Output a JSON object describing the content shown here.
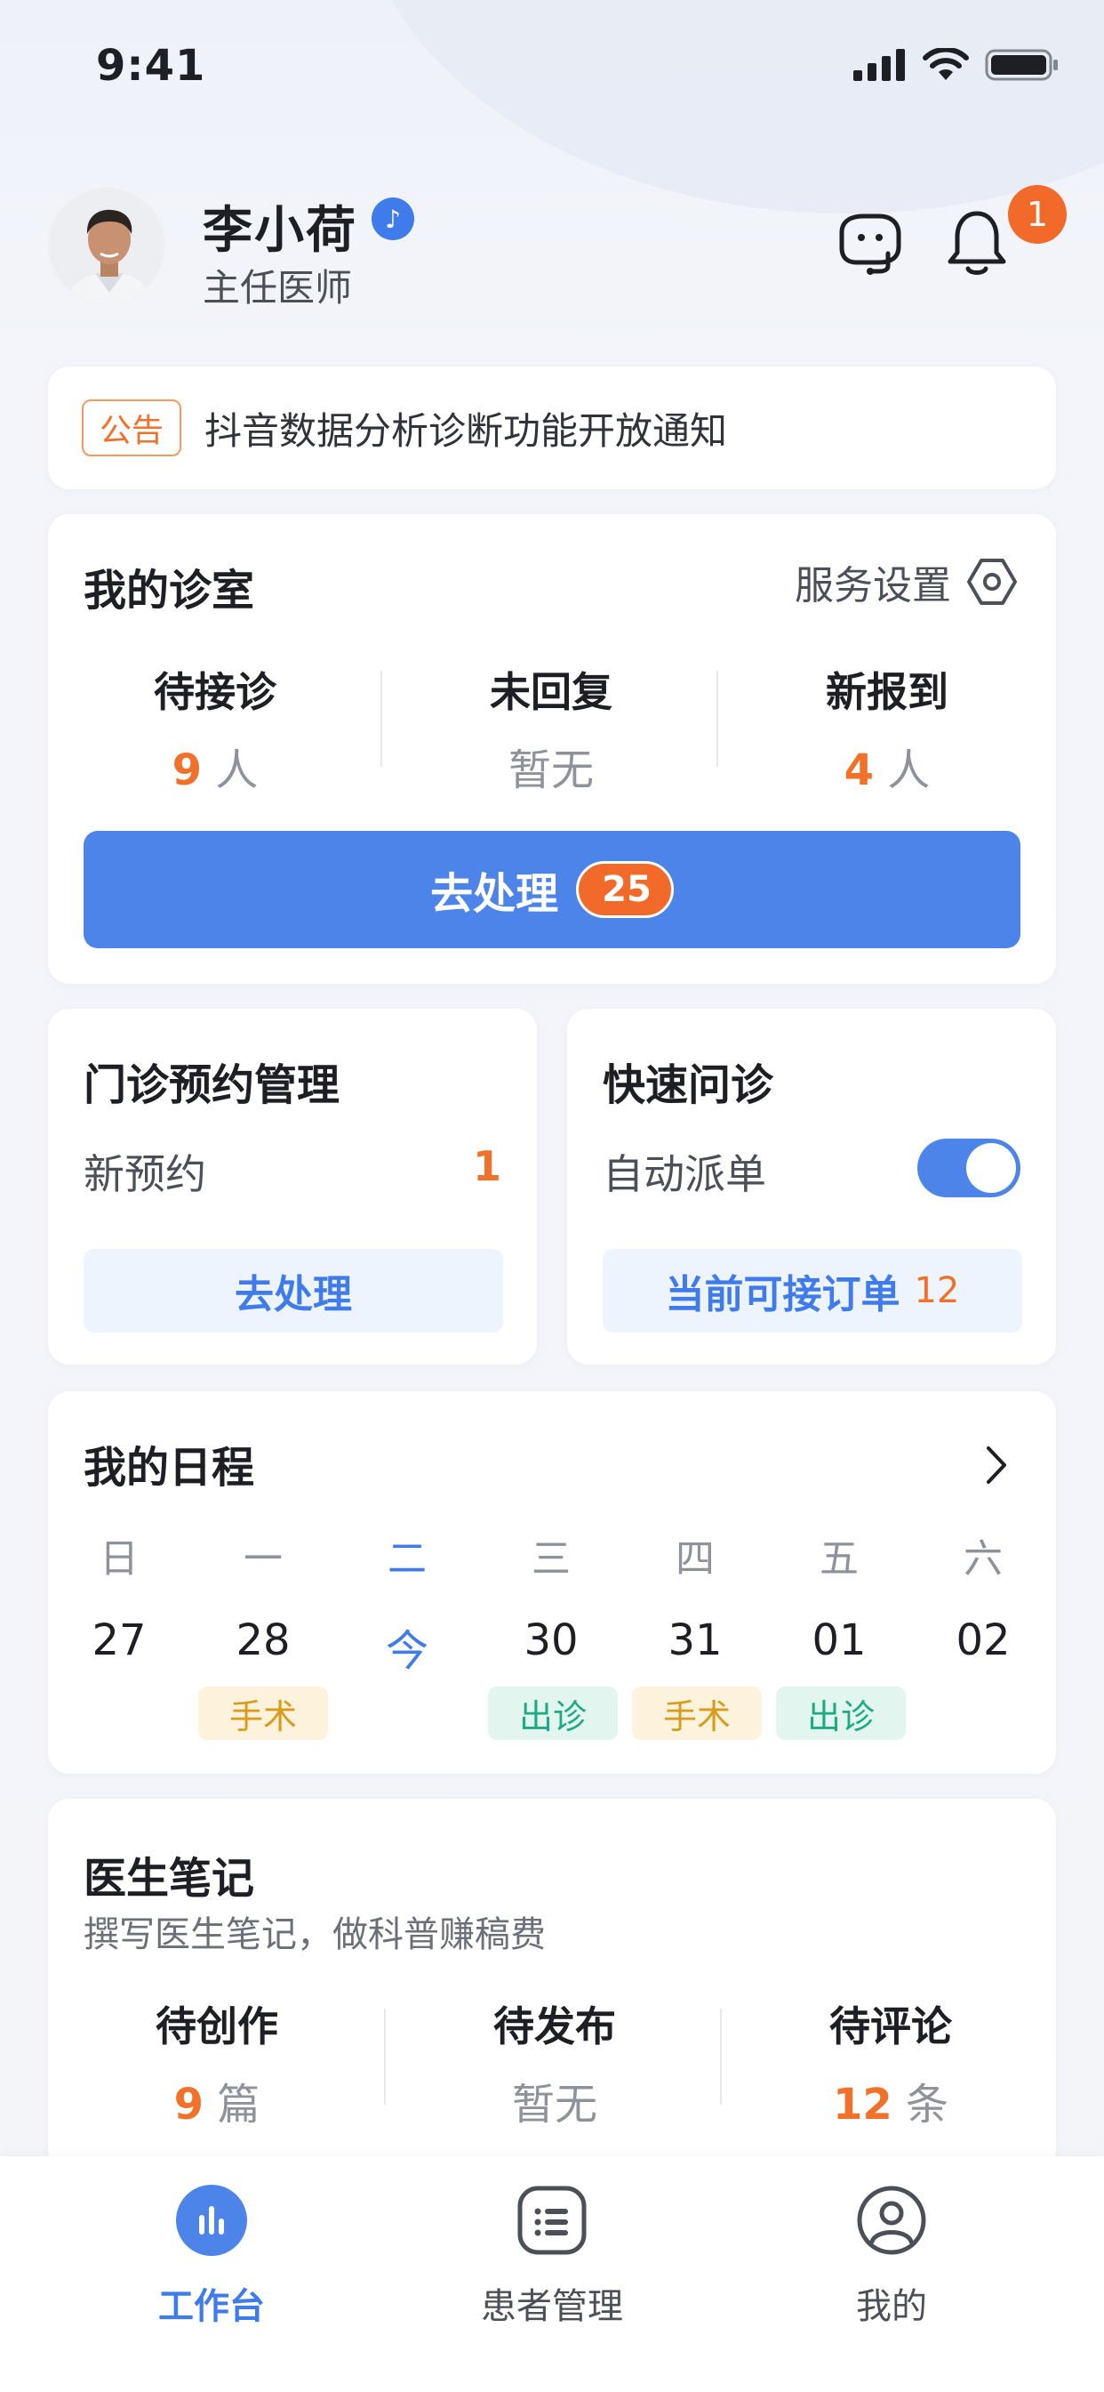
{
  "status_bar": {
    "time": "9:41"
  },
  "profile": {
    "name": "李小荷",
    "role": "主任医师",
    "verified_icon": "tiktok-verified-icon",
    "notification_count": "1"
  },
  "notice": {
    "tag": "公告",
    "text": "抖音数据分析诊断功能开放通知"
  },
  "clinic": {
    "title": "我的诊室",
    "settings_label": "服务设置",
    "stats": [
      {
        "label": "待接诊",
        "number": "9",
        "unit": "人",
        "empty": ""
      },
      {
        "label": "未回复",
        "number": "",
        "unit": "",
        "empty": "暂无"
      },
      {
        "label": "新报到",
        "number": "4",
        "unit": "人",
        "empty": ""
      }
    ],
    "action_label": "去处理",
    "action_badge": "25"
  },
  "appointments": {
    "title": "门诊预约管理",
    "row_label": "新预约",
    "row_value": "1",
    "button_label": "去处理"
  },
  "quick_consult": {
    "title": "快速问诊",
    "row_label": "自动派单",
    "toggle_on": true,
    "button_label": "当前可接订单",
    "button_count": "12"
  },
  "schedule": {
    "title": "我的日程",
    "days": [
      {
        "weekday": "日",
        "date": "27",
        "tag": "",
        "tag_type": ""
      },
      {
        "weekday": "一",
        "date": "28",
        "tag": "手术",
        "tag_type": "surg"
      },
      {
        "weekday": "二",
        "date": "今",
        "tag": "",
        "tag_type": "",
        "today": true
      },
      {
        "weekday": "三",
        "date": "30",
        "tag": "出诊",
        "tag_type": "out"
      },
      {
        "weekday": "四",
        "date": "31",
        "tag": "手术",
        "tag_type": "surg"
      },
      {
        "weekday": "五",
        "date": "01",
        "tag": "出诊",
        "tag_type": "out"
      },
      {
        "weekday": "六",
        "date": "02",
        "tag": "",
        "tag_type": ""
      }
    ]
  },
  "notes": {
    "title": "医生笔记",
    "subtitle": "撰写医生笔记，做科普赚稿费",
    "stats": [
      {
        "label": "待创作",
        "number": "9",
        "unit": "篇",
        "empty": ""
      },
      {
        "label": "待发布",
        "number": "",
        "unit": "",
        "empty": "暂无"
      },
      {
        "label": "待评论",
        "number": "12",
        "unit": "条",
        "empty": ""
      }
    ]
  },
  "tabbar": [
    {
      "label": "工作台",
      "icon": "dashboard-chart-icon",
      "active": true
    },
    {
      "label": "患者管理",
      "icon": "list-icon",
      "active": false
    },
    {
      "label": "我的",
      "icon": "user-icon",
      "active": false
    }
  ],
  "colors": {
    "primary": "#4d84ea",
    "accent": "#f26a2a",
    "surgery_tag": "#d89b1c",
    "outpatient_tag": "#1faa84"
  }
}
